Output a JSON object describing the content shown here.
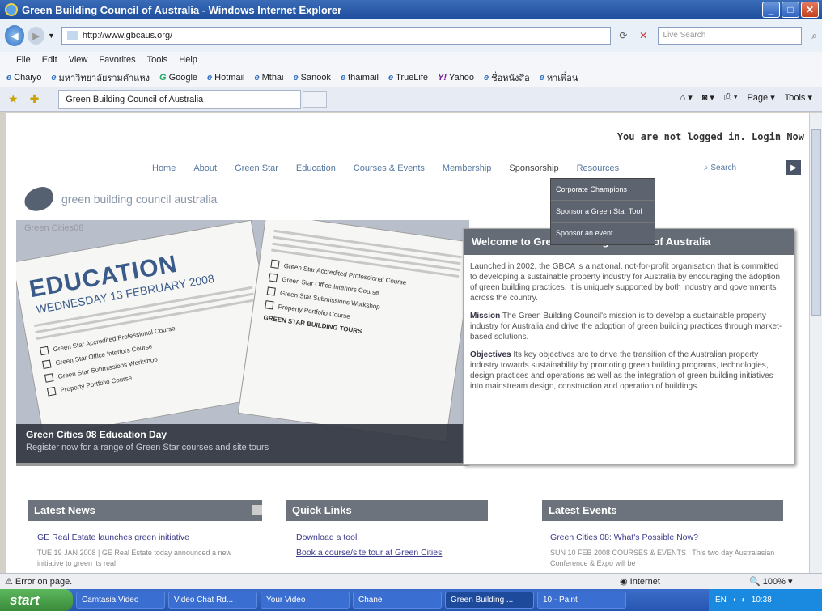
{
  "window": {
    "title": "Green Building Council of Australia - Windows Internet Explorer"
  },
  "address": {
    "url": "http://www.gbcaus.org/",
    "search_placeholder": "Live Search"
  },
  "menu": [
    "File",
    "Edit",
    "View",
    "Favorites",
    "Tools",
    "Help"
  ],
  "links": [
    "Chaiyo",
    "มหาวิทยาลัยรามคำแหง",
    "Google",
    "Hotmail",
    "Mthai",
    "Sanook",
    "thaimail",
    "TrueLife",
    "Yahoo",
    "ชื่อหนังสือ",
    "หาเพื่อน"
  ],
  "tab": {
    "label": "Green Building Council of Australia"
  },
  "commandbar": {
    "page": "Page",
    "tools": "Tools"
  },
  "site": {
    "login_text": "You are not logged in. Login Now",
    "nav": [
      "Home",
      "About",
      "Green Star",
      "Education",
      "Courses & Events",
      "Membership",
      "Sponsorship",
      "Resources"
    ],
    "search_label": "Search",
    "logo_text": "green building council australia",
    "sponsorship_menu": [
      "Corporate Champions",
      "Sponsor a Green Star Tool",
      "Sponsor an event"
    ],
    "hero": {
      "tag": "Green Cities08",
      "flyer_title": "EDUCATION",
      "flyer_date": "WEDNESDAY 13 FEBRUARY 2008",
      "flyer_rows": [
        "Green Star Accredited Professional Course",
        "Green Star Office Interiors Course",
        "Green Star Submissions Workshop",
        "Property Portfolio Course",
        "GREEN STAR BUILDING TOURS"
      ],
      "caption_title": "Green Cities 08 Education Day",
      "caption_sub": "Register now for a range of Green Star courses and site tours"
    },
    "welcome": {
      "heading": "Welcome to Green Building Council of Australia",
      "intro": "Launched in 2002, the GBCA is a national, not-for-profit organisation that is committed to developing a sustainable property industry for Australia by encouraging the adoption of green building practices. It is uniquely supported by both industry and governments across the country.",
      "mission_label": "Mission",
      "mission_text": "The Green Building Council's mission is to develop a sustainable property industry for Australia and drive the adoption of green building practices through market-based solutions.",
      "objectives_label": "Objectives",
      "objectives_text": "Its key objectives are to drive the transition of the Australian property industry towards sustainability by promoting green building programs, technologies, design practices and operations as well as the integration of green building initiatives into mainstream design, construction and operation of buildings."
    },
    "latest_news": {
      "heading": "Latest News",
      "link": "GE Real Estate launches green initiative",
      "meta": "TUE 19 JAN 2008 | GE Real Estate today announced a new initiative to green its real"
    },
    "quick_links": {
      "heading": "Quick Links",
      "items": [
        "Download a tool",
        "Book a course/site tour at Green Cities"
      ]
    },
    "latest_events": {
      "heading": "Latest Events",
      "link": "Green Cities 08: What's Possible Now?",
      "meta": "SUN 10 FEB 2008 COURSES & EVENTS | This two day Australasian Conference & Expo will be"
    }
  },
  "status": {
    "error_text": "Error on page.",
    "zone": "Internet",
    "zoom": "100%"
  },
  "taskbar": {
    "start": "start",
    "items": [
      "Camtasia Video",
      "Video Chat Rd...",
      "Your Video",
      "Chane",
      "Green Building ...",
      "10 - Paint"
    ],
    "clock": "10:38",
    "lang": "EN"
  }
}
